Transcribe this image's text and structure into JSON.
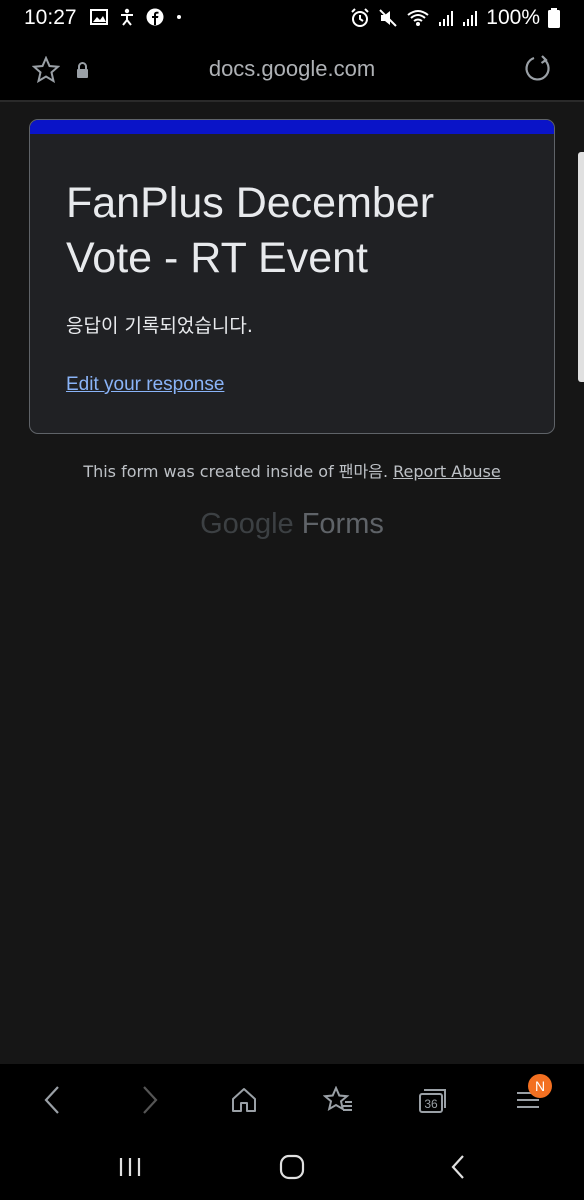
{
  "status_bar": {
    "time": "10:27",
    "battery_text": "100%",
    "left_icons": [
      "image-icon",
      "accessibility-icon",
      "facebook-icon",
      "dot-icon"
    ],
    "right_icons": [
      "alarm-icon",
      "mute-icon",
      "wifi-icon",
      "signal-icon",
      "signal-icon",
      "battery-icon"
    ]
  },
  "browser": {
    "url": "docs.google.com",
    "tab_count": "36",
    "menu_badge": "N"
  },
  "form": {
    "title": "FanPlus December Vote - RT Event",
    "confirmation": "응답이 기록되었습니다.",
    "edit_link": "Edit your response",
    "accent_color": "#0a14c8"
  },
  "footer": {
    "note": "This form was created inside of 팬마음.",
    "report_link": "Report Abuse",
    "brand_google": "Google",
    "brand_forms": "Forms"
  }
}
